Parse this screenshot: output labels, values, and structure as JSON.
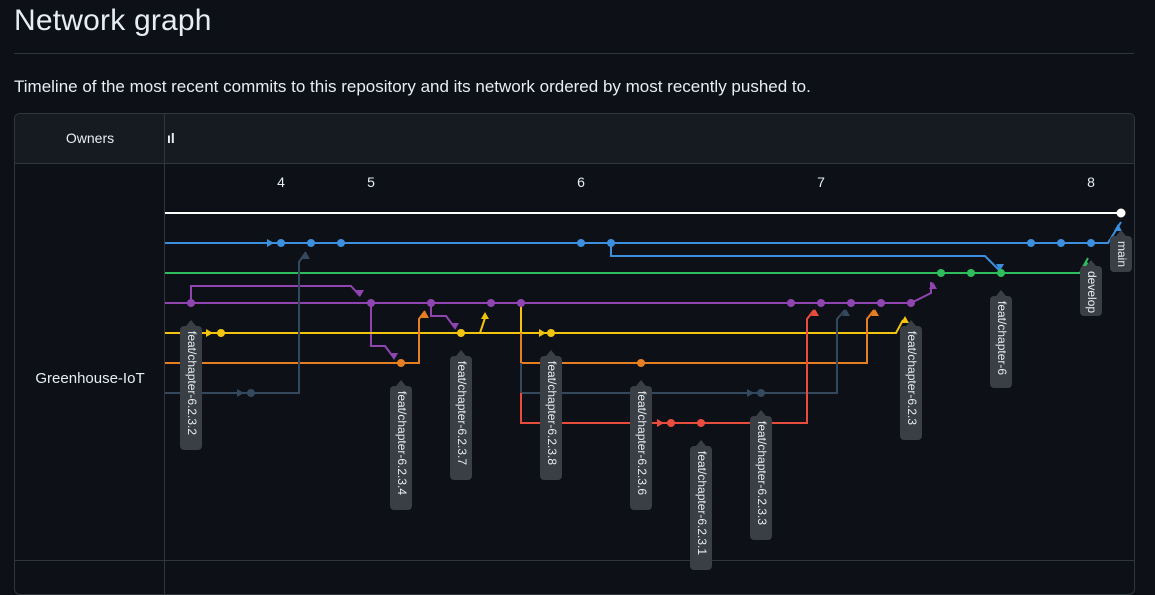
{
  "page": {
    "title": "Network graph",
    "subtitle": "Timeline of the most recent commits to this repository and its network ordered by most recently pushed to."
  },
  "graph": {
    "owners_label": "Owners",
    "header_mark": "ıl",
    "owner": "Greenhouse-IoT",
    "ticks": [
      {
        "label": "4",
        "x": 4
      },
      {
        "label": "5",
        "x": 5
      },
      {
        "label": "6",
        "x": 6
      },
      {
        "label": "7",
        "x": 7
      },
      {
        "label": "8",
        "x": 8
      }
    ],
    "branch_colors": {
      "main": "#ffffff",
      "blue": "#3b8fdc",
      "green": "#2fbc5c",
      "purple": "#8f44b0",
      "yellow": "#f2c40f",
      "orange": "#e67e22",
      "slate": "#34495e",
      "red": "#e74c3c"
    },
    "labels": [
      {
        "name": "main",
        "text": "main"
      },
      {
        "name": "develop",
        "text": "develop"
      },
      {
        "name": "feat-chapter-6",
        "text": "feat/chapter-6"
      },
      {
        "name": "feat-chapter-6-2-3",
        "text": "feat/chapter-6.2.3"
      },
      {
        "name": "feat-chapter-6-2-3-2",
        "text": "feat/chapter-6.2.3.2"
      },
      {
        "name": "feat-chapter-6-2-3-4",
        "text": "feat/chapter-6.2.3.4"
      },
      {
        "name": "feat-chapter-6-2-3-7",
        "text": "feat/chapter-6.2.3.7"
      },
      {
        "name": "feat-chapter-6-2-3-8",
        "text": "feat/chapter-6.2.3.8"
      },
      {
        "name": "feat-chapter-6-2-3-6",
        "text": "feat/chapter-6.2.3.6"
      },
      {
        "name": "feat-chapter-6-2-3-1",
        "text": "feat/chapter-6.2.3.1"
      },
      {
        "name": "feat-chapter-6-2-3-3",
        "text": "feat/chapter-6.2.3.3"
      }
    ]
  }
}
